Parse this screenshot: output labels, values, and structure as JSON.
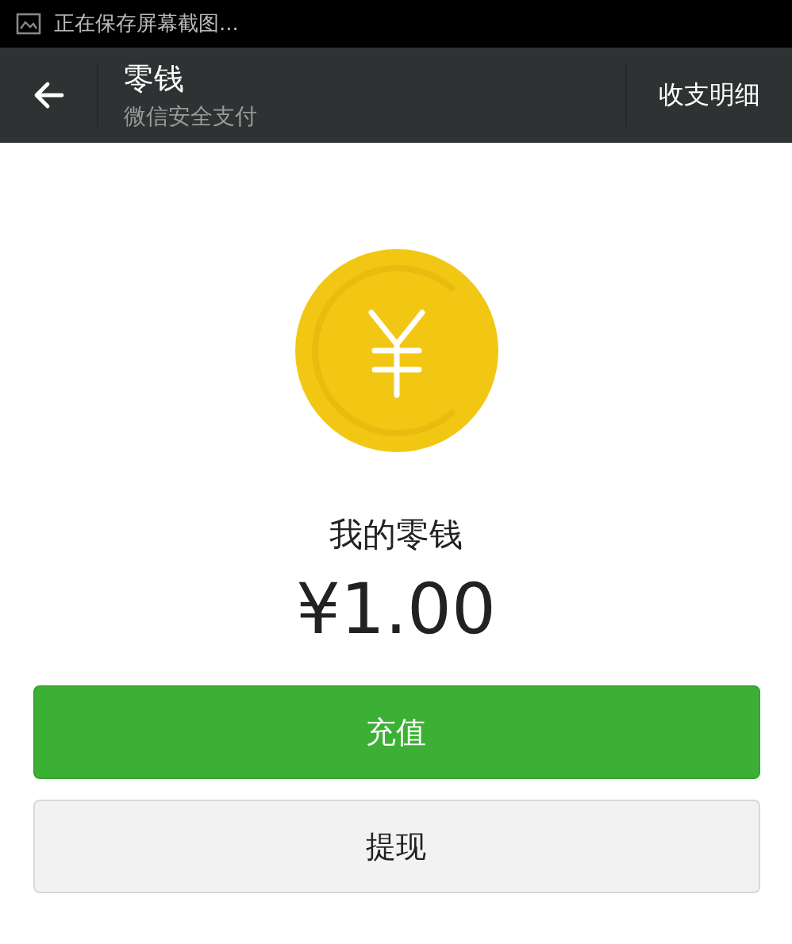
{
  "status_bar": {
    "notification": "正在保存屏幕截图..."
  },
  "header": {
    "title": "零钱",
    "subtitle": "微信安全支付",
    "action": "收支明细"
  },
  "balance": {
    "label": "我的零钱",
    "amount": "¥1.00"
  },
  "buttons": [
    {
      "label": "充值",
      "kind": "primary"
    },
    {
      "label": "提现",
      "kind": "secondary"
    }
  ]
}
